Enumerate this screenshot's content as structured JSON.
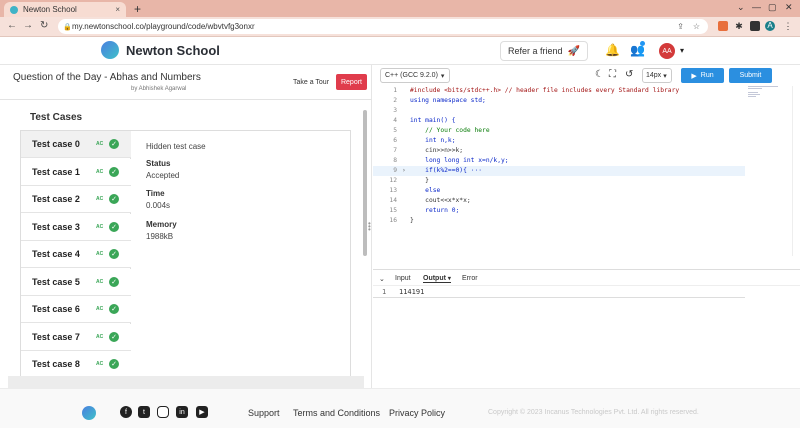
{
  "browser": {
    "tab_title": "Newton School",
    "tab_close": "×",
    "new_tab": "+",
    "url": "my.newtonschool.co/playground/code/wbvtvfg3onxr",
    "profile_initial": "A"
  },
  "header": {
    "logo_text": "Newton School",
    "refer_label": "Refer a friend",
    "avatar_initials": "AA"
  },
  "question": {
    "title": "Question of the Day - Abhas and Numbers",
    "author": "by Abhishek Agarwal",
    "tour_label": "Take a Tour",
    "report_label": "Report"
  },
  "test_cases": {
    "heading": "Test Cases",
    "items": [
      {
        "name": "Test case 0",
        "badge": "AC"
      },
      {
        "name": "Test case 1",
        "badge": "AC"
      },
      {
        "name": "Test case 2",
        "badge": "AC"
      },
      {
        "name": "Test case 3",
        "badge": "AC"
      },
      {
        "name": "Test case 4",
        "badge": "AC"
      },
      {
        "name": "Test case 5",
        "badge": "AC"
      },
      {
        "name": "Test case 6",
        "badge": "AC"
      },
      {
        "name": "Test case 7",
        "badge": "AC"
      },
      {
        "name": "Test case 8",
        "badge": "AC"
      }
    ],
    "selected": {
      "description": "Hidden test case",
      "status_label": "Status",
      "status_value": "Accepted",
      "time_label": "Time",
      "time_value": "0.004s",
      "memory_label": "Memory",
      "memory_value": "1988kB"
    }
  },
  "editor": {
    "language": "C++ (GCC 9.2.0)",
    "font_size": "14px",
    "run_label": "Run",
    "submit_label": "Submit",
    "lines": [
      "#include <bits/stdc++.h> // header file includes every Standard library",
      "using namespace std;",
      "",
      "int main() {",
      "    // Your code here",
      "    int n,k;",
      "    cin>>n>>k;",
      "    long long int x=n/k,y;",
      "    if(k%2==0){ ···",
      "    }",
      "    else",
      "    cout<<x*x*x;",
      "    return 0;",
      "}"
    ],
    "line_numbers": [
      "1",
      "2",
      "3",
      "4",
      "5",
      "6",
      "7",
      "8",
      "9",
      "12",
      "13",
      "14",
      "15",
      "16"
    ]
  },
  "output": {
    "tabs": [
      "Input",
      "Output",
      "Error"
    ],
    "active_tab": "Output",
    "line_number": "1",
    "value": "114191"
  },
  "footer": {
    "links": [
      "Support",
      "Terms and Conditions",
      "Privacy Policy"
    ],
    "copyright": "Copyright © 2023 Incanus Technologies Pvt. Ltd. All rights reserved."
  },
  "colors": {
    "accent": "#2b8fe0",
    "report": "#e03c4c",
    "success": "#3aa657"
  }
}
